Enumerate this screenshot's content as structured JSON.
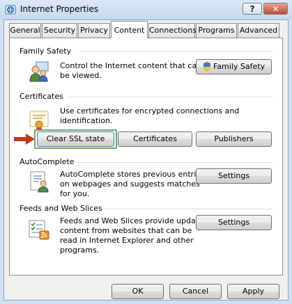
{
  "window": {
    "title": "Internet Properties",
    "help_label": "?",
    "close_label": "✕"
  },
  "tabs": [
    "General",
    "Security",
    "Privacy",
    "Content",
    "Connections",
    "Programs",
    "Advanced"
  ],
  "sections": {
    "family_safety": {
      "title": "Family Safety",
      "text": [
        "Control the Internet content that can",
        "be viewed."
      ],
      "button": "Family Safety"
    },
    "certificates": {
      "title": "Certificates",
      "text": "Use certificates for encrypted connections and identification.",
      "buttons": [
        "Clear SSL state",
        "Certificates",
        "Publishers"
      ]
    },
    "autocomplete": {
      "title": "AutoComplete",
      "text": [
        "AutoComplete stores previous entries",
        "on webpages and suggests matches",
        "for you."
      ],
      "button": "Settings"
    },
    "feeds": {
      "title": "Feeds and Web Slices",
      "text": [
        "Feeds and Web Slices provide updated",
        "content from websites that can be",
        "read in Internet Explorer and other",
        "programs."
      ],
      "button": "Settings"
    }
  },
  "footer": {
    "ok": "OK",
    "cancel": "Cancel",
    "apply": "Apply"
  },
  "icons": {
    "app": "internet-globe-icon",
    "family_safety": "users-icon",
    "shield": "uac-shield-icon",
    "certificate": "certificate-icon",
    "autocomplete": "form-user-icon",
    "feeds": "feed-list-icon",
    "arrow": "red-arrow-icon"
  },
  "colors": {
    "highlight_border": "#6fa86a",
    "arrow": "#c0391b"
  }
}
